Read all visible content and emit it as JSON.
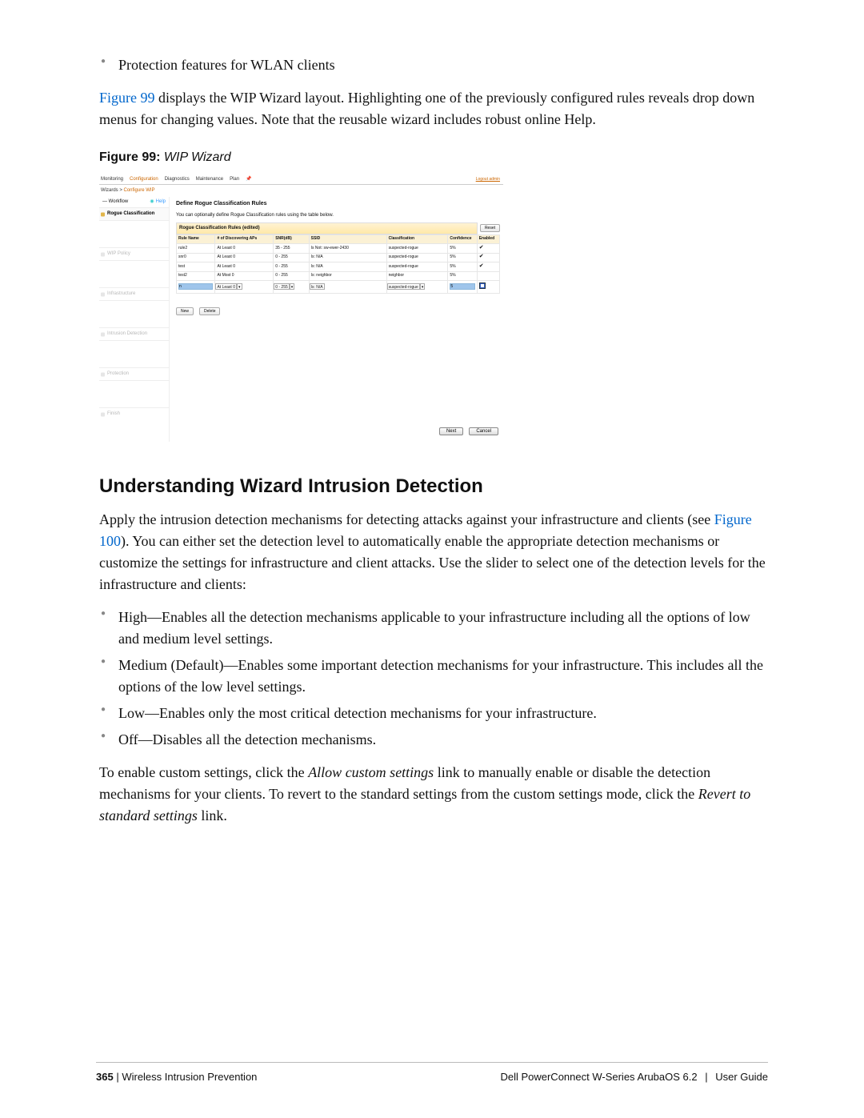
{
  "intro_bullet": "Protection features for WLAN clients",
  "fig_link": "Figure 99",
  "fig_txt": " displays the WIP Wizard layout. Highlighting one of the previously configured rules reveals drop down menus for changing values. Note that the reusable wizard includes robust online Help.",
  "figcap_num": "Figure 99:",
  "figcap_title": " WIP Wizard",
  "shot": {
    "tabs": [
      "Monitoring",
      "Configuration",
      "Diagnostics",
      "Maintenance",
      "Plan"
    ],
    "logout": "Logout admin",
    "bc_pre": "Wizards > ",
    "bc_cur": "Configure WIP",
    "wf_head": "Workflow",
    "help": "Help",
    "steps": [
      "Rogue Classification",
      "WIP Policy",
      "Infrastructure",
      "Intrusion Detection",
      "Protection",
      "Finish"
    ],
    "panel_title": "Define Rogue Classification Rules",
    "panel_sub": "You can optionally define Rogue Classification rules using the table below.",
    "tbl_title": "Rogue Classification Rules (edited)",
    "reset": "Reset",
    "cols": [
      "Rule Name",
      "# of Discovering APs",
      "SNR(dB)",
      "SSID",
      "Classification",
      "Confidence",
      "Enabled"
    ],
    "rows": [
      {
        "name": "rule2",
        "disc": "At Least 0",
        "snr": "35 - 255",
        "ssid": "Is Not: sw-ewer-2430",
        "cls": "suspected-rogue",
        "conf": "5%",
        "en": true
      },
      {
        "name": "snr0",
        "disc": "At Least 0",
        "snr": "0 - 255",
        "ssid": "Is: N/A",
        "cls": "suspected-rogue",
        "conf": "5%",
        "en": true
      },
      {
        "name": "test",
        "disc": "At Least 0",
        "snr": "0 - 255",
        "ssid": "Is: N/A",
        "cls": "suspected-rogue",
        "conf": "5%",
        "en": true
      },
      {
        "name": "test2",
        "disc": "At Most 0",
        "snr": "0 - 255",
        "ssid": "Is: neighbor",
        "cls": "neighbor",
        "conf": "5%",
        "en": false
      }
    ],
    "selrow": {
      "name": "n",
      "disc": "At Least 0",
      "snrsel": "0 - 255",
      "ssid": "Is: N/A",
      "cls": "suspected-rogue",
      "conf": "5"
    },
    "new": "New",
    "del": "Delete",
    "next": "Next",
    "cancel": "Cancel"
  },
  "h3": "Understanding Wizard Intrusion Detection",
  "p1_a": "Apply the intrusion detection mechanisms for detecting attacks against your infrastructure and clients (see ",
  "p1_link": "Figure 100",
  "p1_b": "). You can either set the detection level to automatically enable the appropriate detection mechanisms or customize the settings for infrastructure and client attacks. Use the slider to select one of the detection levels for the infrastructure and clients:",
  "list": [
    "High—Enables all the detection mechanisms applicable to your infrastructure including all the options of low and medium level settings.",
    "Medium (Default)—Enables some important detection mechanisms for your infrastructure. This includes all the options of the low level settings.",
    "Low—Enables only the most critical detection mechanisms for your infrastructure.",
    "Off—Disables all the detection mechanisms."
  ],
  "p2_a": "To enable custom settings, click the ",
  "p2_i1": "Allow custom settings",
  "p2_b": " link to manually enable or disable the detection mechanisms for your clients. To revert to the standard settings from the custom settings mode, click the ",
  "p2_i2": "Revert to standard settings",
  "p2_c": " link.",
  "foot": {
    "page": "365",
    "section": "Wireless Intrusion Prevention",
    "product": "Dell PowerConnect W-Series ArubaOS 6.2",
    "doc": "User Guide"
  }
}
